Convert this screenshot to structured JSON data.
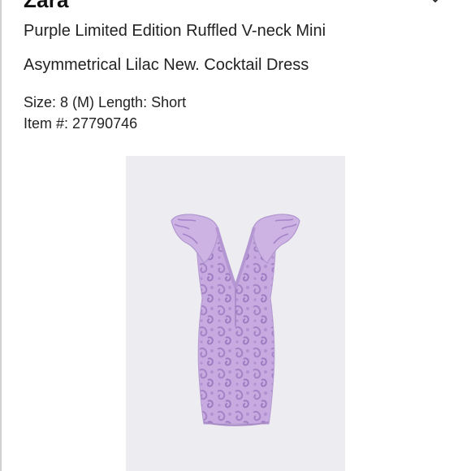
{
  "listing": {
    "brand": "Zara",
    "title_line_1": "Purple Limited Edition Ruffled V-neck Mini",
    "title_line_2": "Asymmetrical Lilac New. Cocktail Dress",
    "size_line": "Size: 8 (M) Length: Short",
    "item_line": "Item #: 27790746"
  },
  "icons": {
    "header_action": "chevron-down-icon"
  },
  "image": {
    "subject": "product-photo-lilac-dress"
  },
  "colors": {
    "text": "#222222",
    "photo_background": "#ededf1",
    "dress_base": "#c3a6dd",
    "dress_pattern": "#a887c9"
  }
}
